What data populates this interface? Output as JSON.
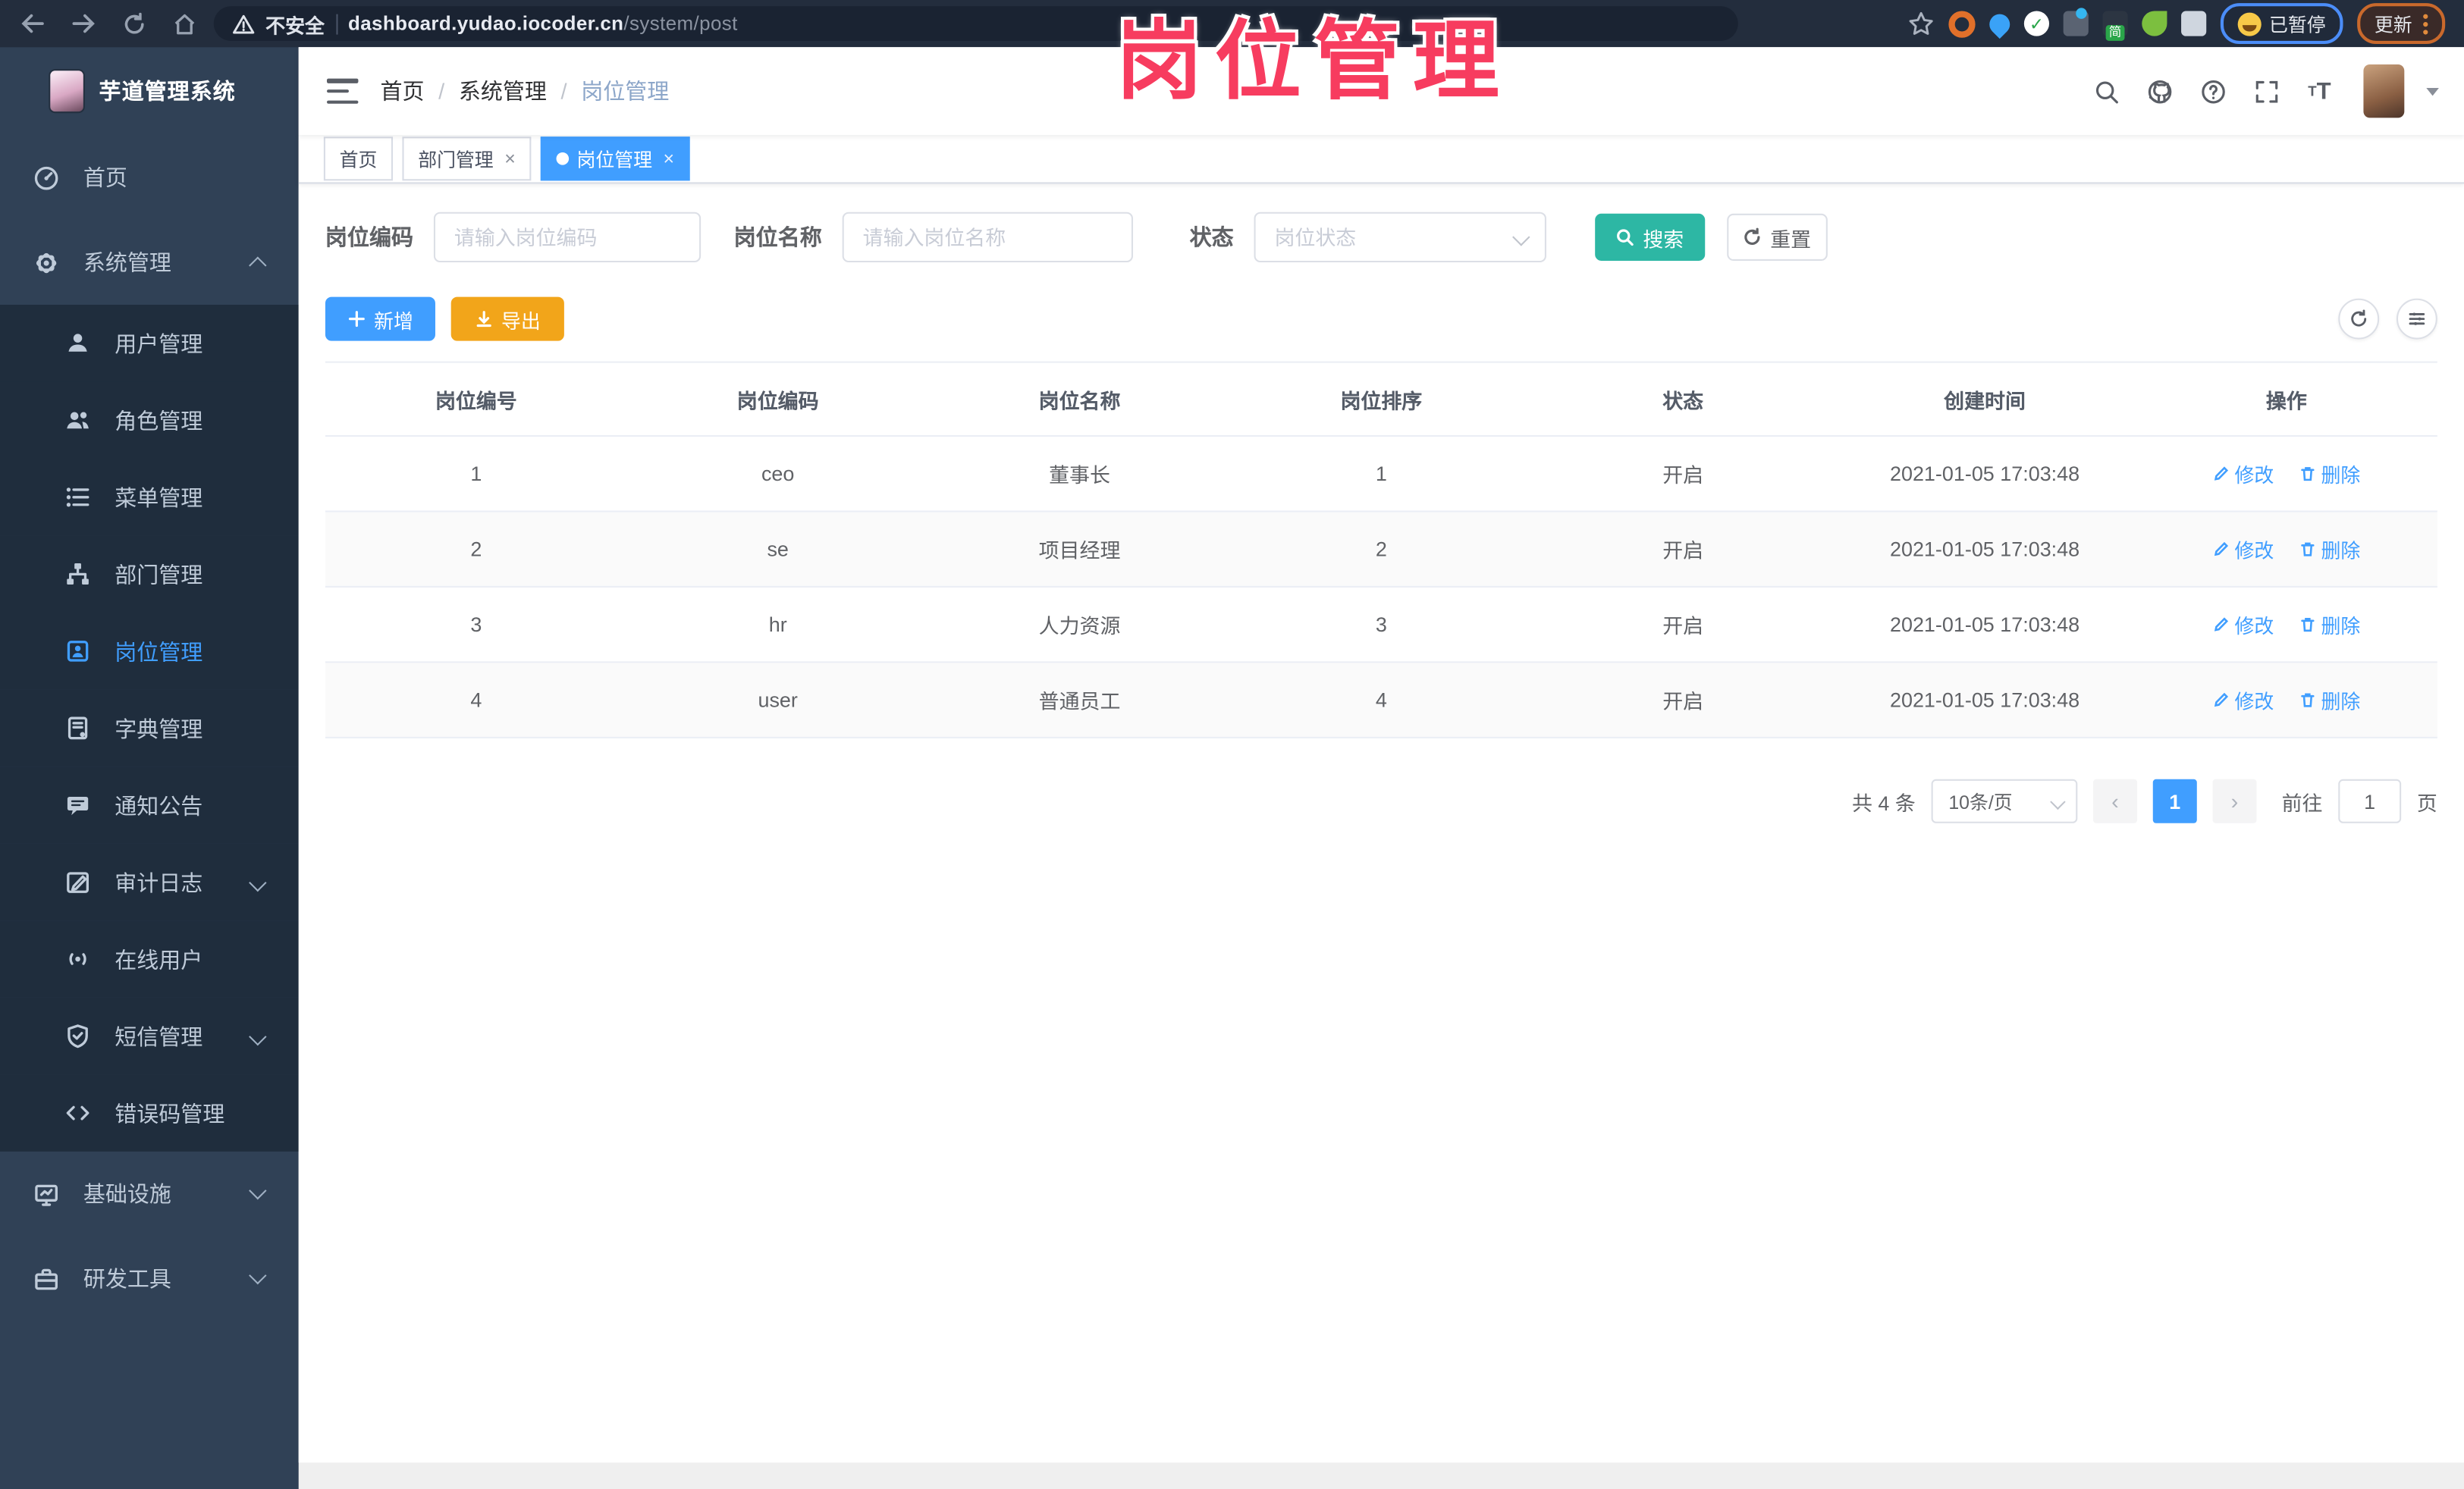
{
  "browser": {
    "security_label": "不安全",
    "url_host": "dashboard.yudao.iocoder.cn",
    "url_path": "/system/post",
    "paused_label": "已暂停",
    "update_label": "更新",
    "extension_badge": "简"
  },
  "annotation": {
    "text": "岗位管理"
  },
  "sidebar": {
    "title": "芋道管理系统",
    "items": [
      {
        "label": "首页"
      },
      {
        "label": "系统管理"
      },
      {
        "label": "用户管理"
      },
      {
        "label": "角色管理"
      },
      {
        "label": "菜单管理"
      },
      {
        "label": "部门管理"
      },
      {
        "label": "岗位管理"
      },
      {
        "label": "字典管理"
      },
      {
        "label": "通知公告"
      },
      {
        "label": "审计日志"
      },
      {
        "label": "在线用户"
      },
      {
        "label": "短信管理"
      },
      {
        "label": "错误码管理"
      },
      {
        "label": "基础设施"
      },
      {
        "label": "研发工具"
      }
    ]
  },
  "header": {
    "breadcrumb": [
      "首页",
      "系统管理",
      "岗位管理"
    ],
    "separator": "/"
  },
  "tabs": {
    "close_glyph": "×",
    "items": [
      {
        "label": "首页"
      },
      {
        "label": "部门管理"
      },
      {
        "label": "岗位管理"
      }
    ]
  },
  "filters": {
    "code_label": "岗位编码",
    "code_placeholder": "请输入岗位编码",
    "name_label": "岗位名称",
    "name_placeholder": "请输入岗位名称",
    "status_label": "状态",
    "status_placeholder": "岗位状态",
    "search_label": "搜索",
    "reset_label": "重置"
  },
  "toolbar": {
    "add_label": "新增",
    "export_label": "导出"
  },
  "table": {
    "columns": [
      "岗位编号",
      "岗位编码",
      "岗位名称",
      "岗位排序",
      "状态",
      "创建时间",
      "操作"
    ],
    "rows": [
      [
        "1",
        "ceo",
        "董事长",
        "1",
        "开启",
        "2021-01-05 17:03:48"
      ],
      [
        "2",
        "se",
        "项目经理",
        "2",
        "开启",
        "2021-01-05 17:03:48"
      ],
      [
        "3",
        "hr",
        "人力资源",
        "3",
        "开启",
        "2021-01-05 17:03:48"
      ],
      [
        "4",
        "user",
        "普通员工",
        "4",
        "开启",
        "2021-01-05 17:03:48"
      ]
    ],
    "action_edit": "修改",
    "action_delete": "删除"
  },
  "pagination": {
    "total": "共 4 条",
    "page_size": "10条/页",
    "prev_glyph": "‹",
    "current": "1",
    "next_glyph": "›",
    "goto_label": "前往",
    "goto_value": "1",
    "goto_unit": "页"
  },
  "colors": {
    "accent": "#409eff",
    "search_teal": "#2db7a4",
    "export_orange": "#f2a51a",
    "annotation_pink": "#f73c5f",
    "sidebar_bg": "#304156",
    "submenu_bg": "#1f2d3d"
  }
}
